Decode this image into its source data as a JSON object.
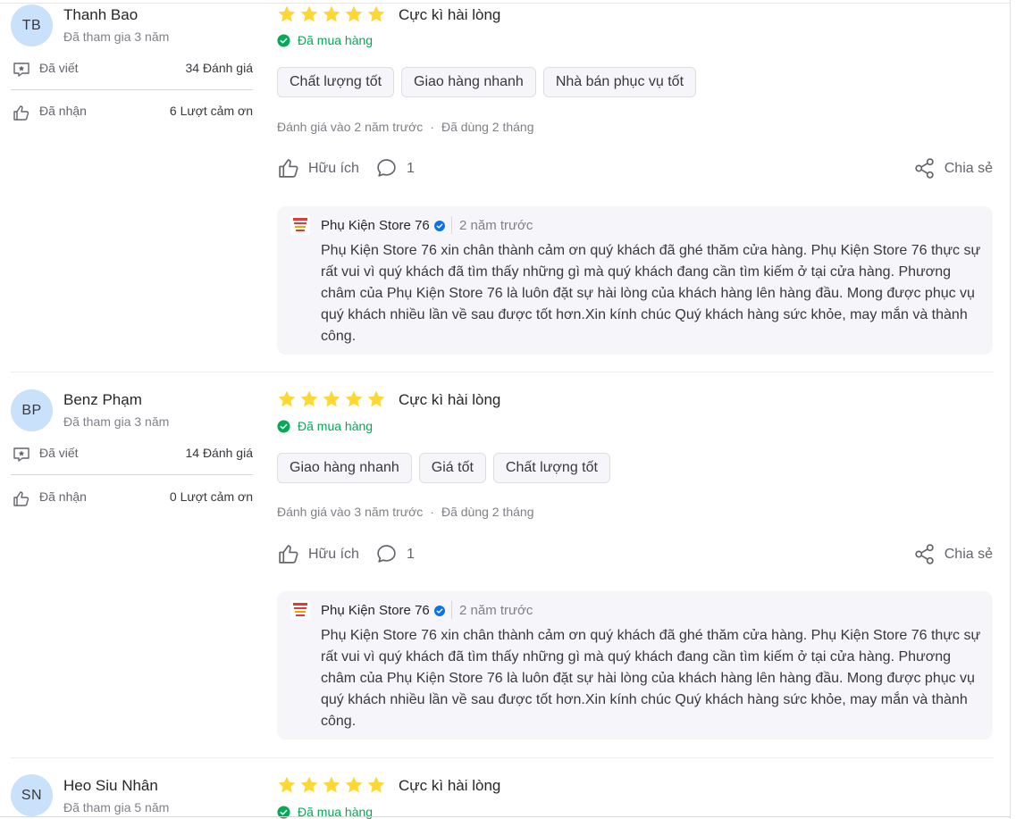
{
  "colors": {
    "star": "#fdd835",
    "verified_green": "#00ab56",
    "verified_blue": "#0b74e5",
    "avatar_bg": "#c9e1fb",
    "reply_bg": "#f5f5fa"
  },
  "icons": {
    "written": "message-star-icon",
    "received": "thumb-up-icon",
    "helpful": "thumb-up-icon",
    "comment": "comment-bubble-icon",
    "share": "share-icon",
    "bought": "check-circle-icon",
    "shop_verified": "verified-badge-icon"
  },
  "reviews": [
    {
      "initials": "TB",
      "name": "Thanh Bao",
      "joined": "Đã tham gia 3 năm",
      "written_label": "Đã viết",
      "written_value": "34 Đánh giá",
      "received_label": "Đã nhận",
      "received_value": "6 Lượt cảm ơn",
      "rating": 5,
      "title": "Cực kì hài lòng",
      "bought": "Đã mua hàng",
      "tags": [
        "Chất lượng tốt",
        "Giao hàng nhanh",
        "Nhà bán phục vụ tốt"
      ],
      "reviewed_at": "Đánh giá vào 2 năm trước",
      "dot": "·",
      "used_for": "Đã dùng 2 tháng",
      "helpful": "Hữu ích",
      "comments": "1",
      "share": "Chia sẻ",
      "reply": {
        "shop": "Phụ Kiện Store 76",
        "time": "2 năm trước",
        "text": "Phụ Kiện Store 76 xin chân thành cảm ơn quý khách đã ghé thăm cửa hàng. Phụ Kiện Store 76 thực sự rất vui vì quý khách đã tìm thấy những gì mà quý khách đang cần tìm kiếm ở tại cửa hàng. Phương châm của Phụ Kiện Store 76 là luôn đặt sự hài lòng của khách hàng lên hàng đầu. Mong được phục vụ quý khách nhiều lần về sau được tốt hơn.Xin kính chúc Quý khách hàng sức khỏe, may mắn và thành công."
      }
    },
    {
      "initials": "BP",
      "name": "Benz Phạm",
      "joined": "Đã tham gia 3 năm",
      "written_label": "Đã viết",
      "written_value": "14 Đánh giá",
      "received_label": "Đã nhận",
      "received_value": "0 Lượt cảm ơn",
      "rating": 5,
      "title": "Cực kì hài lòng",
      "bought": "Đã mua hàng",
      "tags": [
        "Giao hàng nhanh",
        "Giá tốt",
        "Chất lượng tốt"
      ],
      "reviewed_at": "Đánh giá vào 3 năm trước",
      "dot": "·",
      "used_for": "Đã dùng 2 tháng",
      "helpful": "Hữu ích",
      "comments": "1",
      "share": "Chia sẻ",
      "reply": {
        "shop": "Phụ Kiện Store 76",
        "time": "2 năm trước",
        "text": "Phụ Kiện Store 76 xin chân thành cảm ơn quý khách đã ghé thăm cửa hàng. Phụ Kiện Store 76 thực sự rất vui vì quý khách đã tìm thấy những gì mà quý khách đang cần tìm kiếm ở tại cửa hàng. Phương châm của Phụ Kiện Store 76 là luôn đặt sự hài lòng của khách hàng lên hàng đầu. Mong được phục vụ quý khách nhiều lần về sau được tốt hơn.Xin kính chúc Quý khách hàng sức khỏe, may mắn và thành công."
      }
    },
    {
      "initials": "SN",
      "name": "Heo Siu Nhân",
      "joined": "Đã tham gia 5 năm",
      "rating": 5,
      "title": "Cực kì hài lòng",
      "bought": "Đã mua hàng"
    }
  ]
}
